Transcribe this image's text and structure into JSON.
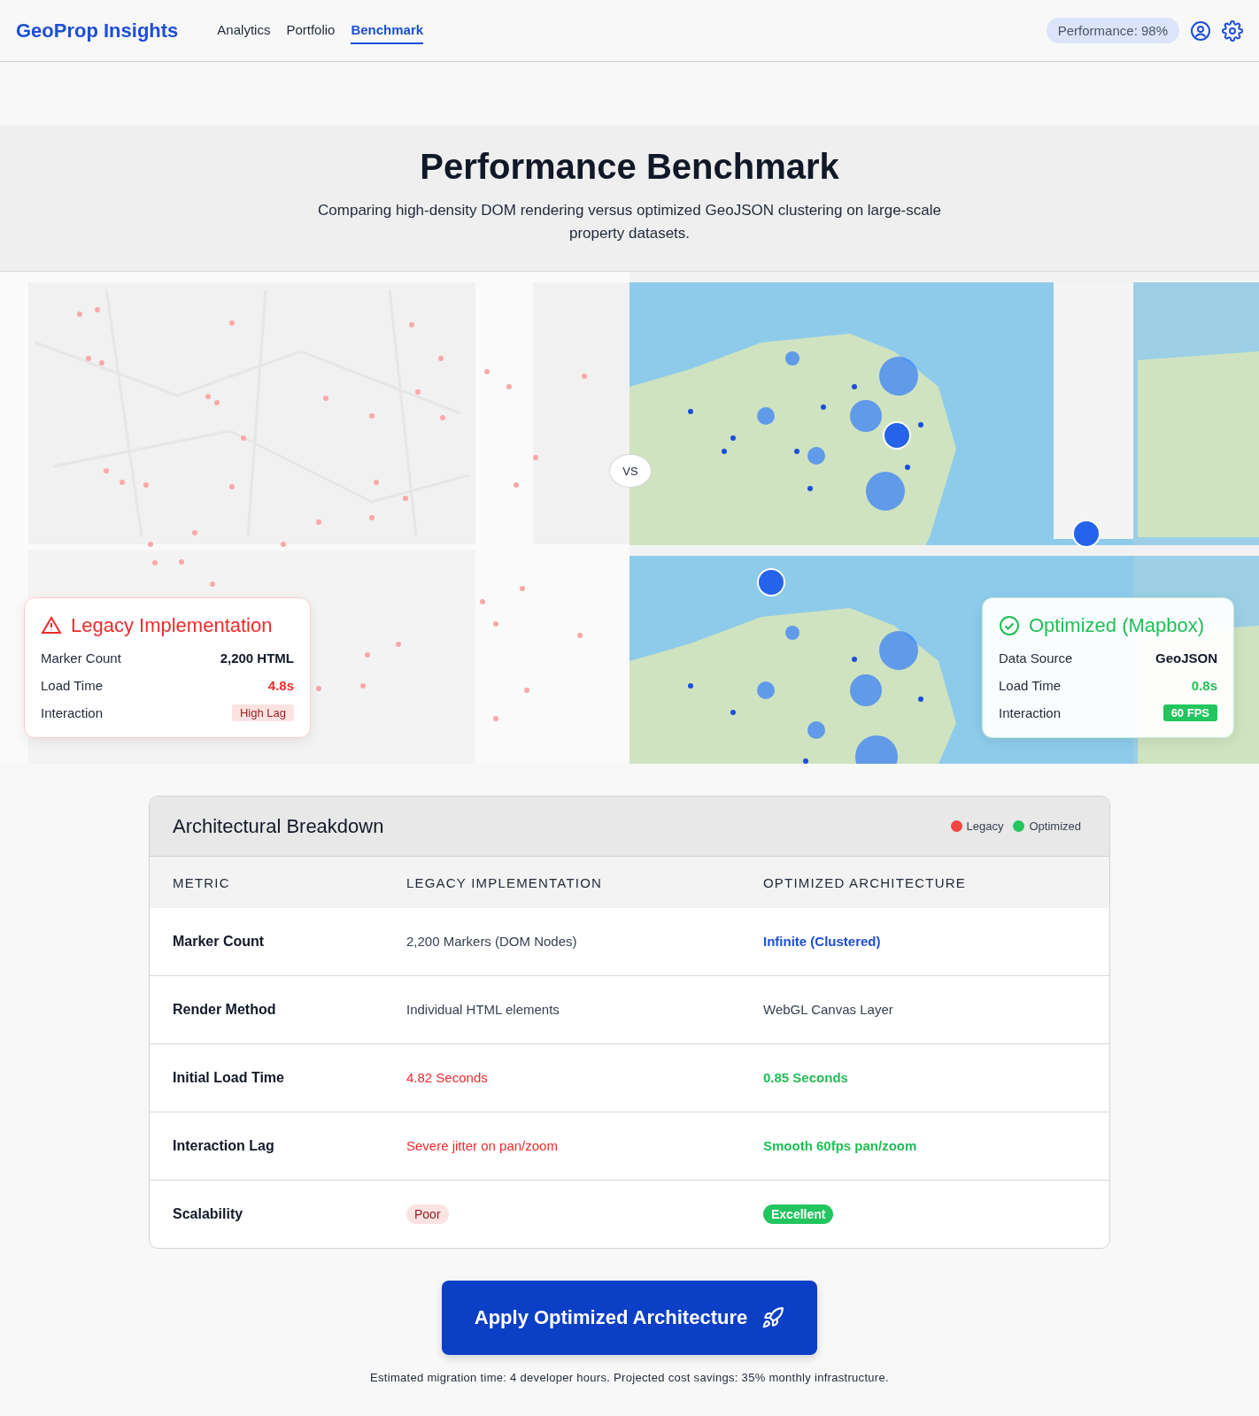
{
  "brand": "GeoProp Insights",
  "nav": [
    {
      "label": "Analytics",
      "selected": false
    },
    {
      "label": "Portfolio",
      "selected": false
    },
    {
      "label": "Benchmark",
      "selected": true
    }
  ],
  "performance_badge": "Performance: 98%",
  "hero": {
    "title": "Performance Benchmark",
    "subtitle": "Comparing high-density DOM rendering versus optimized GeoJSON clustering on large-scale property datasets."
  },
  "comparison": {
    "divider": "VS",
    "cards": [
      {
        "kind": "legacy",
        "title": "Legacy Implementation",
        "rows": [
          {
            "label": "Marker Count",
            "value": "2,200 HTML",
            "kind": "plain"
          },
          {
            "label": "Load Time",
            "value": "4.8s",
            "kind": "bad"
          },
          {
            "label": "Interaction",
            "value": "High Lag",
            "kind": "badbadge"
          }
        ]
      },
      {
        "kind": "optimized",
        "title": "Optimized (Mapbox)",
        "rows": [
          {
            "label": "Data Source",
            "value": "GeoJSON",
            "kind": "plain"
          },
          {
            "label": "Load Time",
            "value": "0.8s",
            "kind": "good"
          },
          {
            "label": "Interaction",
            "value": "60 FPS",
            "kind": "goodbadge"
          }
        ]
      }
    ]
  },
  "breakdown": {
    "title": "Architectural Breakdown",
    "legend": [
      {
        "label": "Legacy",
        "color": "#ef4444"
      },
      {
        "label": "Optimized",
        "color": "#22c55e"
      }
    ],
    "columns": [
      "METRIC",
      "LEGACY IMPLEMENTATION",
      "OPTIMIZED ARCHITECTURE"
    ],
    "rows": [
      {
        "metric": "Marker Count",
        "legacy": {
          "text": "2,200 Markers (DOM Nodes)",
          "kind": "plain"
        },
        "optimized": {
          "text": "Infinite (Clustered)",
          "kind": "link"
        }
      },
      {
        "metric": "Render Method",
        "legacy": {
          "text": "Individual HTML elements",
          "kind": "plain"
        },
        "optimized": {
          "text": "WebGL Canvas Layer",
          "kind": "plain"
        }
      },
      {
        "metric": "Initial Load Time",
        "legacy": {
          "text": "4.82 Seconds",
          "kind": "bad"
        },
        "optimized": {
          "text": "0.85 Seconds",
          "kind": "good"
        }
      },
      {
        "metric": "Interaction Lag",
        "legacy": {
          "text": "Severe jitter on pan/zoom",
          "kind": "bad"
        },
        "optimized": {
          "text": "Smooth 60fps pan/zoom",
          "kind": "good"
        }
      },
      {
        "metric": "Scalability",
        "legacy": {
          "text": "Poor",
          "kind": "badbadge"
        },
        "optimized": {
          "text": "Excellent",
          "kind": "goodbadge"
        }
      }
    ]
  },
  "cta": {
    "label": "Apply Optimized Architecture"
  },
  "footnote": "Estimated migration time: 4 developer hours. Projected cost savings: 35% monthly infrastructure."
}
